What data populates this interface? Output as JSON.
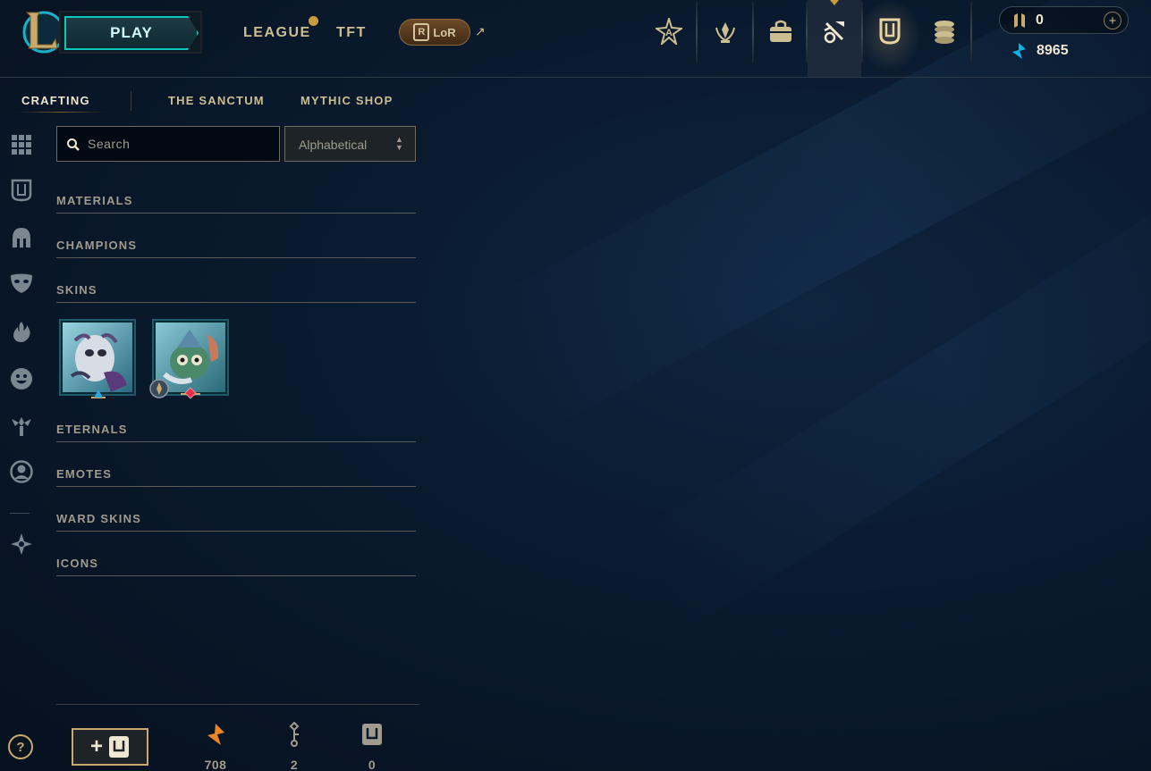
{
  "header": {
    "play_label": "PLAY",
    "nav": [
      {
        "label": "LEAGUE"
      },
      {
        "label": "TFT"
      }
    ],
    "lor_label": "LoR",
    "lor_r": "R",
    "rp_value": "0",
    "blue_essence_value": "8965",
    "icons": [
      "eternals-star-icon",
      "challenges-icon",
      "store-bag-icon",
      "loot-crafting-icon",
      "collection-icon",
      "currency-coins-icon"
    ]
  },
  "subtabs": [
    {
      "label": "CRAFTING",
      "active": true
    },
    {
      "label": "THE SANCTUM"
    },
    {
      "label": "MYTHIC SHOP"
    }
  ],
  "search": {
    "placeholder": "Search",
    "value": ""
  },
  "sort": {
    "selected": "Alphabetical"
  },
  "categories": [
    {
      "label": "MATERIALS"
    },
    {
      "label": "CHAMPIONS"
    },
    {
      "label": "SKINS"
    },
    {
      "label": "ETERNALS"
    },
    {
      "label": "EMOTES"
    },
    {
      "label": "WARD SKINS"
    },
    {
      "label": "ICONS"
    }
  ],
  "skins": [
    {
      "rarity": "epic",
      "gem_color": "#2fa6d8"
    },
    {
      "rarity": "legendary",
      "gem_color": "#e8304a"
    }
  ],
  "sidebar_icons": [
    "grid-icon",
    "chest-icon",
    "helmet-icon",
    "mask-icon",
    "flame-icon",
    "emote-face-icon",
    "ward-icon",
    "profile-icon",
    "banner-icon"
  ],
  "footer": {
    "help_label": "?",
    "add_label": "+",
    "orange_essence": "708",
    "keys": "2",
    "chests": "0"
  },
  "colors": {
    "gold": "#c8aa6e",
    "teal": "#0ac8b9",
    "background": "#0a1a2e"
  }
}
